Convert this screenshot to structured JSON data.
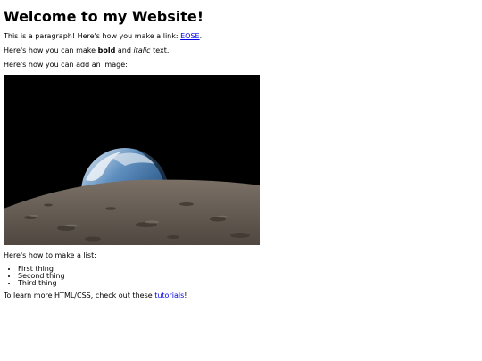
{
  "heading": "Welcome to my Website!",
  "para1": {
    "prefix": "This is a paragraph! Here's how you make a link: ",
    "link_text": "EOSE",
    "suffix": "."
  },
  "para2": {
    "prefix": "Here's how you can make ",
    "bold": "bold",
    "middle": " and ",
    "italic": "italic",
    "suffix": " text."
  },
  "para3": "Here's how you can add an image:",
  "image": {
    "subject": "earthrise-over-moon",
    "colors": {
      "space": "#000000",
      "ocean": "#3f6f9f",
      "cloud": "#dfe8f0",
      "moon": "#6b6258"
    }
  },
  "para4": "Here's how to make a list:",
  "list": [
    "First thing",
    "Second thing",
    "Third thing"
  ],
  "para5": {
    "prefix": "To learn more HTML/CSS, check out these ",
    "link_text": "tutorials",
    "suffix": "!"
  }
}
